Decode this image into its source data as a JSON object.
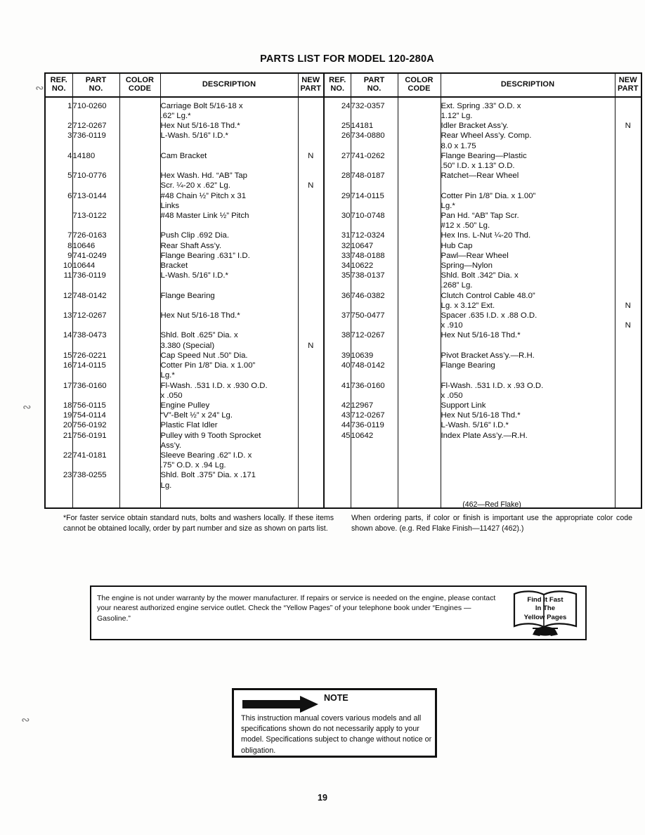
{
  "document": {
    "title": "PARTS LIST FOR MODEL 120-280A",
    "page_number": "19"
  },
  "table": {
    "headers": {
      "ref_no": "REF.\nNO.",
      "part_no": "PART\nNO.",
      "color_code": "COLOR\nCODE",
      "description": "DESCRIPTION",
      "new_part": "NEW\nPART"
    },
    "left_rows": [
      {
        "ref": "1",
        "part": "710-0260",
        "color": "",
        "desc": "Carriage Bolt 5/16-18 x\n     .62” Lg.*",
        "new": ""
      },
      {
        "ref": "2",
        "part": "712-0267",
        "color": "",
        "desc": "Hex Nut 5/16-18 Thd.*",
        "new": ""
      },
      {
        "ref": "3",
        "part": "736-0119",
        "color": "",
        "desc": "L-Wash. 5/16” I.D.*",
        "new": ""
      },
      {
        "ref": "4",
        "part": "14180",
        "color": "",
        "desc": "Cam Bracket",
        "new": "N"
      },
      {
        "ref": "5",
        "part": "710-0776",
        "color": "",
        "desc": "Hex Wash. Hd. “AB” Tap\n     Scr. ¼-20 x .62” Lg.",
        "new": "N",
        "new_offset": 1
      },
      {
        "ref": "6",
        "part": "713-0144",
        "color": "",
        "desc": "#48 Chain ½” Pitch x 31\n     Links",
        "new": ""
      },
      {
        "ref": "",
        "part": "713-0122",
        "color": "",
        "desc": "#48 Master Link ½” Pitch",
        "new": ""
      },
      {
        "ref": "7",
        "part": "726-0163",
        "color": "",
        "desc": "Push Clip .692 Dia.",
        "new": ""
      },
      {
        "ref": "8",
        "part": "10646",
        "color": "",
        "desc": "Rear Shaft Ass’y.",
        "new": ""
      },
      {
        "ref": "9",
        "part": "741-0249",
        "color": "",
        "desc": "Flange Bearing .631” I.D.",
        "new": ""
      },
      {
        "ref": "10",
        "part": "10644",
        "color": "",
        "desc": "Bracket",
        "new": ""
      },
      {
        "ref": "11",
        "part": "736-0119",
        "color": "",
        "desc": "L-Wash. 5/16” I.D.*",
        "new": ""
      },
      {
        "ref": "12",
        "part": "748-0142",
        "color": "",
        "desc": "Flange Bearing",
        "new": ""
      },
      {
        "ref": "13",
        "part": "712-0267",
        "color": "",
        "desc": "Hex Nut 5/16-18 Thd.*",
        "new": ""
      },
      {
        "ref": "14",
        "part": "738-0473",
        "color": "",
        "desc": "Shld. Bolt .625” Dia. x\n     3.380 (Special)",
        "new": "N",
        "new_offset": 1
      },
      {
        "ref": "15",
        "part": "726-0221",
        "color": "",
        "desc": "Cap Speed Nut .50” Dia.",
        "new": ""
      },
      {
        "ref": "16",
        "part": "714-0115",
        "color": "",
        "desc": "Cotter Pin 1/8” Dia. x 1.00”\n     Lg.*",
        "new": ""
      },
      {
        "ref": "17",
        "part": "736-0160",
        "color": "",
        "desc": "Fl-Wash. .531 I.D. x .930 O.D.\n     x .050",
        "new": ""
      },
      {
        "ref": "18",
        "part": "756-0115",
        "color": "",
        "desc": "Engine Pulley",
        "new": ""
      },
      {
        "ref": "19",
        "part": "754-0114",
        "color": "",
        "desc": "“V”-Belt ½” x 24” Lg.",
        "new": ""
      },
      {
        "ref": "20",
        "part": "756-0192",
        "color": "",
        "desc": "Plastic Flat Idler",
        "new": ""
      },
      {
        "ref": "21",
        "part": "756-0191",
        "color": "",
        "desc": "Pulley with 9 Tooth Sprocket\n     Ass’y.",
        "new": ""
      },
      {
        "ref": "22",
        "part": "741-0181",
        "color": "",
        "desc": "Sleeve Bearing .62” I.D. x\n     .75” O.D. x .94 Lg.",
        "new": ""
      },
      {
        "ref": "23",
        "part": "738-0255",
        "color": "",
        "desc": "Shld.  Bolt  .375”  Dia.  x  .171\n     Lg.",
        "new": ""
      }
    ],
    "right_rows": [
      {
        "ref": "24",
        "part": "732-0357",
        "color": "",
        "desc": "Ext. Spring .33” O.D. x\n     1.12” Lg.",
        "new": ""
      },
      {
        "ref": "25",
        "part": "14181",
        "color": "",
        "desc": "Idler Bracket Ass’y.",
        "new": "N"
      },
      {
        "ref": "26",
        "part": "734-0880",
        "color": "",
        "desc": "Rear Wheel Ass’y. Comp.\n     8.0 x 1.75",
        "new": ""
      },
      {
        "ref": "27",
        "part": "741-0262",
        "color": "",
        "desc": "Flange Bearing—Plastic\n     .50” I.D. x  1.13” O.D.",
        "new": ""
      },
      {
        "ref": "28",
        "part": "748-0187",
        "color": "",
        "desc": "Ratchet—Rear Wheel",
        "new": ""
      },
      {
        "ref": "29",
        "part": "714-0115",
        "color": "",
        "desc": "Cotter Pin 1/8” Dia. x 1.00”\n     Lg.*",
        "new": ""
      },
      {
        "ref": "30",
        "part": "710-0748",
        "color": "",
        "desc": "Pan Hd. “AB” Tap Scr.\n     #12 x .50” Lg.",
        "new": ""
      },
      {
        "ref": "31",
        "part": "712-0324",
        "color": "",
        "desc": "Hex Ins. L-Nut ¼-20 Thd.",
        "new": ""
      },
      {
        "ref": "32",
        "part": "10647",
        "color": "",
        "desc": "Hub Cap",
        "new": ""
      },
      {
        "ref": "33",
        "part": "748-0188",
        "color": "",
        "desc": "Pawl—Rear Wheel",
        "new": ""
      },
      {
        "ref": "34",
        "part": "10622",
        "color": "",
        "desc": "Spring—Nylon",
        "new": ""
      },
      {
        "ref": "35",
        "part": "738-0137",
        "color": "",
        "desc": "Shld. Bolt .342” Dia. x\n     .268” Lg.",
        "new": ""
      },
      {
        "ref": "36",
        "part": "746-0382",
        "color": "",
        "desc": "Clutch Control Cable 48.0”\n     Lg. x 3.12” Ext.",
        "new": "N",
        "new_offset": 1
      },
      {
        "ref": "37",
        "part": "750-0477",
        "color": "",
        "desc": "Spacer .635 I.D. x .88 O.D.\n     x .910",
        "new": "N",
        "new_offset": 1
      },
      {
        "ref": "38",
        "part": "712-0267",
        "color": "",
        "desc": "Hex Nut 5/16-18 Thd.*",
        "new": ""
      },
      {
        "ref": "39",
        "part": "10639",
        "color": "",
        "desc": "Pivot Bracket Ass’y.—R.H.",
        "new": ""
      },
      {
        "ref": "40",
        "part": "748-0142",
        "color": "",
        "desc": "Flange Bearing",
        "new": ""
      },
      {
        "ref": "41",
        "part": "736-0160",
        "color": "",
        "desc": "Fl-Wash. .531 I.D. x .93 O.D.\n     x .050",
        "new": ""
      },
      {
        "ref": "42",
        "part": "12967",
        "color": "",
        "desc": "Support Link",
        "new": ""
      },
      {
        "ref": "43",
        "part": "712-0267",
        "color": "",
        "desc": "Hex Nut 5/16-18 Thd.*",
        "new": ""
      },
      {
        "ref": "44",
        "part": "736-0119",
        "color": "",
        "desc": "L-Wash. 5/16” I.D.*",
        "new": ""
      },
      {
        "ref": "45",
        "part": "10642",
        "color": "",
        "desc": "Index Plate Ass’y.—R.H.",
        "new": ""
      }
    ]
  },
  "footnotes": {
    "left": "*For faster service obtain standard nuts, bolts and washers locally. If these items cannot be obtained locally, order by part number and size as shown on parts list.",
    "color_code_legend": "(462—Red Flake)",
    "right": "When ordering parts, if color or finish is important use the appropriate color code shown above. (e.g. Red Flake Finish—11427 (462).)"
  },
  "engine_notice": {
    "text": "The engine is not under warranty by the mower manufacturer. If repairs or service is needed on the engine, please contact your nearest authorized engine service outlet. Check the “Yellow Pages” of your telephone book under “Engines — Gasoline.”",
    "yellow_pages_label": "Find It Fast\nIn The\nYellow Pages"
  },
  "note_box": {
    "label": "NOTE",
    "text": "This instruction manual covers various models and all specifications shown do not necessarily apply to your model. Specifications subject to change without notice or obligation."
  },
  "colors": {
    "ink": "#0c0c0c",
    "paper": "#fdfdfc"
  }
}
